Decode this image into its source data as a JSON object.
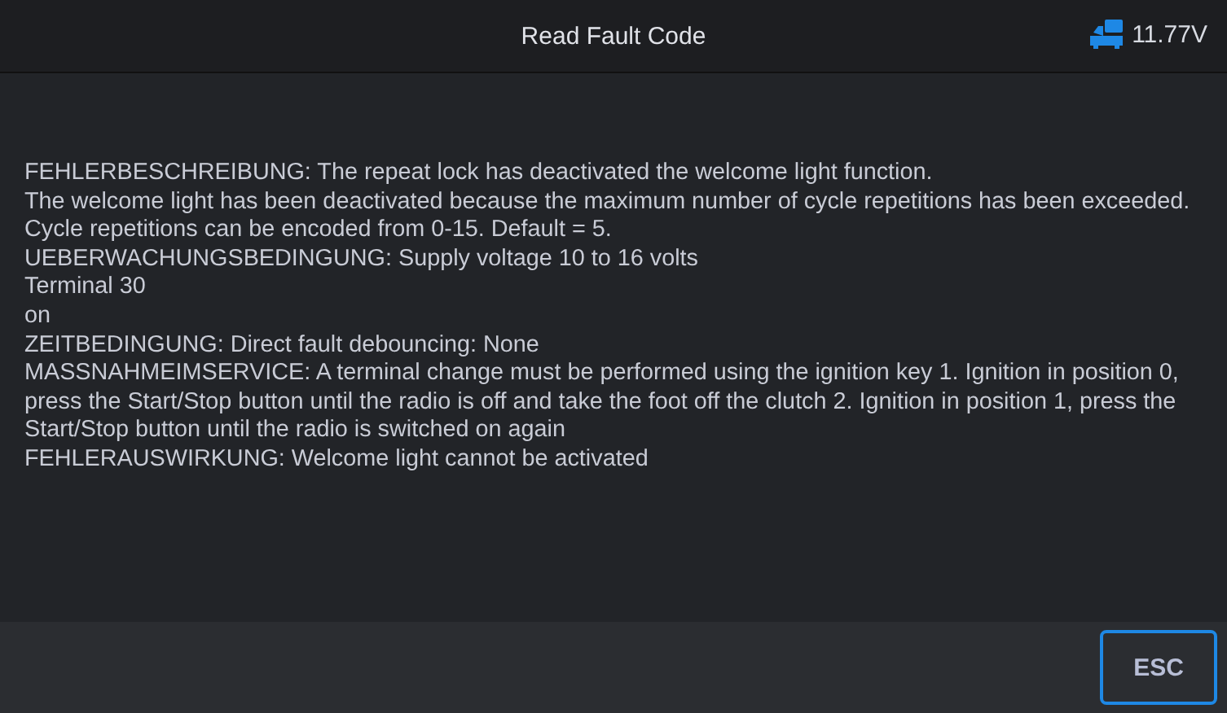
{
  "header": {
    "title": "Read Fault Code",
    "voltage": "11.77V"
  },
  "paragraphs": [
    "FEHLERBESCHREIBUNG: The repeat lock has deactivated the welcome light function.",
    "The welcome light has been deactivated because the maximum number of cycle repetitions has been exceeded.",
    "Cycle repetitions can be encoded from 0-15. Default = 5.",
    "UEBERWACHUNGSBEDINGUNG: Supply voltage 10 to 16 volts",
    "Terminal 30",
    "on",
    "ZEITBEDINGUNG: Direct fault debouncing: None",
    "MASSNAHMEIMSERVICE: A terminal change must be performed using the ignition key 1. Ignition in position 0, press the Start/Stop button until the radio is off and take the foot off the clutch 2. Ignition in position 1, press the Start/Stop button until the radio is switched on again",
    "FEHLERAUSWIRKUNG: Welcome light cannot be activated"
  ],
  "buttons": [
    "ESC"
  ]
}
